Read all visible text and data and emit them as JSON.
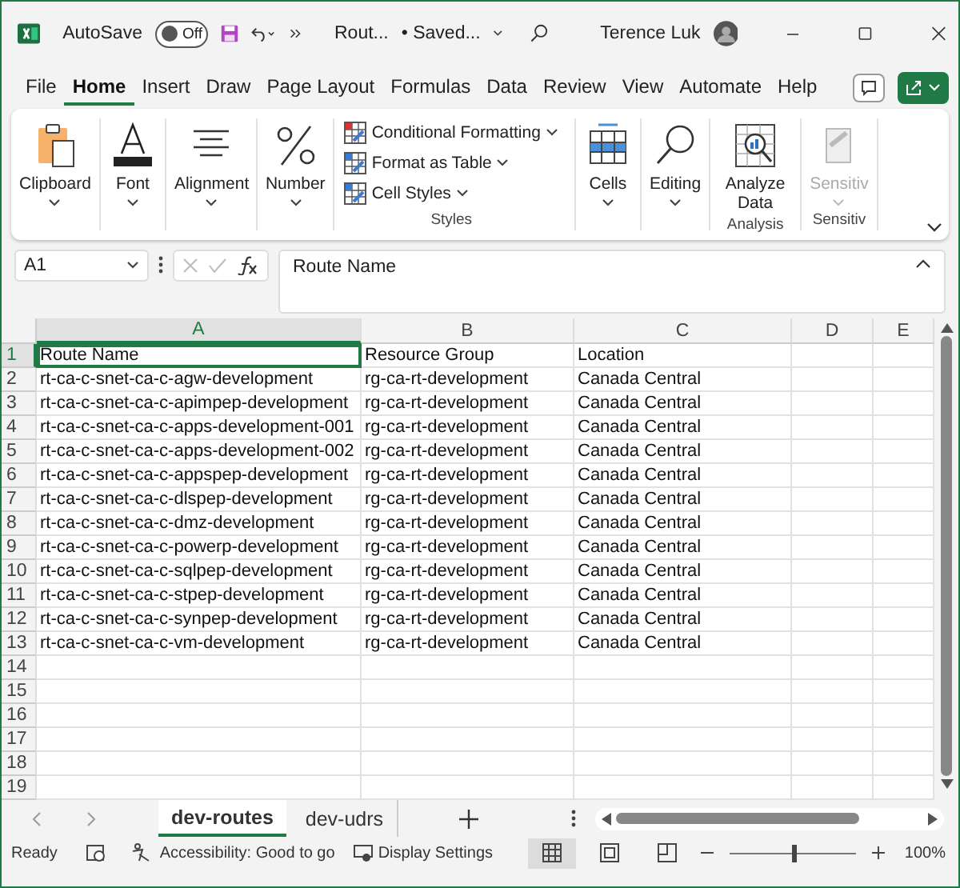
{
  "title_bar": {
    "autosave_label": "AutoSave",
    "autosave_on": false,
    "autosave_state": "Off",
    "file_name": "Rout...",
    "save_status": "• Saved...",
    "user_name": "Terence Luk"
  },
  "menu_tabs": [
    {
      "label": "File",
      "selected": false
    },
    {
      "label": "Home",
      "selected": true
    },
    {
      "label": "Insert",
      "selected": false
    },
    {
      "label": "Draw",
      "selected": false
    },
    {
      "label": "Page Layout",
      "selected": false
    },
    {
      "label": "Formulas",
      "selected": false
    },
    {
      "label": "Data",
      "selected": false
    },
    {
      "label": "Review",
      "selected": false
    },
    {
      "label": "View",
      "selected": false
    },
    {
      "label": "Automate",
      "selected": false
    },
    {
      "label": "Help",
      "selected": false
    }
  ],
  "ribbon": {
    "groups": [
      {
        "buttons": [
          {
            "label": "Clipboard",
            "disabled": false
          }
        ]
      },
      {
        "buttons": [
          {
            "label": "Font",
            "disabled": false
          }
        ]
      },
      {
        "buttons": [
          {
            "label": "Alignment",
            "disabled": false
          }
        ]
      },
      {
        "buttons": [
          {
            "label": "Number",
            "disabled": false
          }
        ]
      },
      {
        "title": "Styles",
        "commands": [
          "Conditional Formatting",
          "Format as Table",
          "Cell Styles"
        ]
      },
      {
        "buttons": [
          {
            "label": "Cells",
            "disabled": false
          }
        ]
      },
      {
        "buttons": [
          {
            "label": "Editing",
            "disabled": false
          }
        ]
      },
      {
        "title": "Analysis",
        "buttons": [
          {
            "label": "Analyze Data",
            "disabled": false
          }
        ]
      },
      {
        "title": "Sensitiv",
        "buttons": [
          {
            "label": "Sensitiv",
            "disabled": true
          }
        ]
      }
    ]
  },
  "formula_bar": {
    "name_box": "A1",
    "formula": "Route Name"
  },
  "grid": {
    "columns": [
      {
        "label": "A",
        "selected": true
      },
      {
        "label": "B",
        "selected": false
      },
      {
        "label": "C",
        "selected": false
      },
      {
        "label": "D",
        "selected": false
      },
      {
        "label": "E",
        "selected": false
      }
    ],
    "rows": [
      {
        "number": "1",
        "selected": true,
        "cells": [
          "Route Name",
          "Resource Group",
          "Location"
        ]
      },
      {
        "number": "2",
        "selected": false,
        "cells": [
          "rt-ca-c-snet-ca-c-agw-development",
          "rg-ca-rt-development",
          "Canada Central"
        ]
      },
      {
        "number": "3",
        "selected": false,
        "cells": [
          "rt-ca-c-snet-ca-c-apimpep-development",
          "rg-ca-rt-development",
          "Canada Central"
        ]
      },
      {
        "number": "4",
        "selected": false,
        "cells": [
          "rt-ca-c-snet-ca-c-apps-development-001",
          "rg-ca-rt-development",
          "Canada Central"
        ]
      },
      {
        "number": "5",
        "selected": false,
        "cells": [
          "rt-ca-c-snet-ca-c-apps-development-002",
          "rg-ca-rt-development",
          "Canada Central"
        ]
      },
      {
        "number": "6",
        "selected": false,
        "cells": [
          "rt-ca-c-snet-ca-c-appspep-development",
          "rg-ca-rt-development",
          "Canada Central"
        ]
      },
      {
        "number": "7",
        "selected": false,
        "cells": [
          "rt-ca-c-snet-ca-c-dlspep-development",
          "rg-ca-rt-development",
          "Canada Central"
        ]
      },
      {
        "number": "8",
        "selected": false,
        "cells": [
          "rt-ca-c-snet-ca-c-dmz-development",
          "rg-ca-rt-development",
          "Canada Central"
        ]
      },
      {
        "number": "9",
        "selected": false,
        "cells": [
          "rt-ca-c-snet-ca-c-powerp-development",
          "rg-ca-rt-development",
          "Canada Central"
        ]
      },
      {
        "number": "10",
        "selected": false,
        "cells": [
          "rt-ca-c-snet-ca-c-sqlpep-development",
          "rg-ca-rt-development",
          "Canada Central"
        ]
      },
      {
        "number": "11",
        "selected": false,
        "cells": [
          "rt-ca-c-snet-ca-c-stpep-development",
          "rg-ca-rt-development",
          "Canada Central"
        ]
      },
      {
        "number": "12",
        "selected": false,
        "cells": [
          "rt-ca-c-snet-ca-c-synpep-development",
          "rg-ca-rt-development",
          "Canada Central"
        ]
      },
      {
        "number": "13",
        "selected": false,
        "cells": [
          "rt-ca-c-snet-ca-c-vm-development",
          "rg-ca-rt-development",
          "Canada Central"
        ]
      },
      {
        "number": "14",
        "selected": false
      },
      {
        "number": "15",
        "selected": false
      },
      {
        "number": "16",
        "selected": false
      },
      {
        "number": "17",
        "selected": false
      },
      {
        "number": "18",
        "selected": false
      },
      {
        "number": "19",
        "selected": false
      }
    ]
  },
  "sheet_tabs": [
    {
      "label": "dev-routes",
      "selected": true
    },
    {
      "label": "dev-udrs",
      "selected": false
    }
  ],
  "status_bar": {
    "ready": "Ready",
    "accessibility": "Accessibility: Good to go",
    "display_settings": "Display Settings",
    "views": [
      {
        "selected": true
      },
      {
        "selected": false
      },
      {
        "selected": false
      }
    ],
    "zoom_slider": {
      "level": 0.5
    },
    "zoom": "100%"
  }
}
